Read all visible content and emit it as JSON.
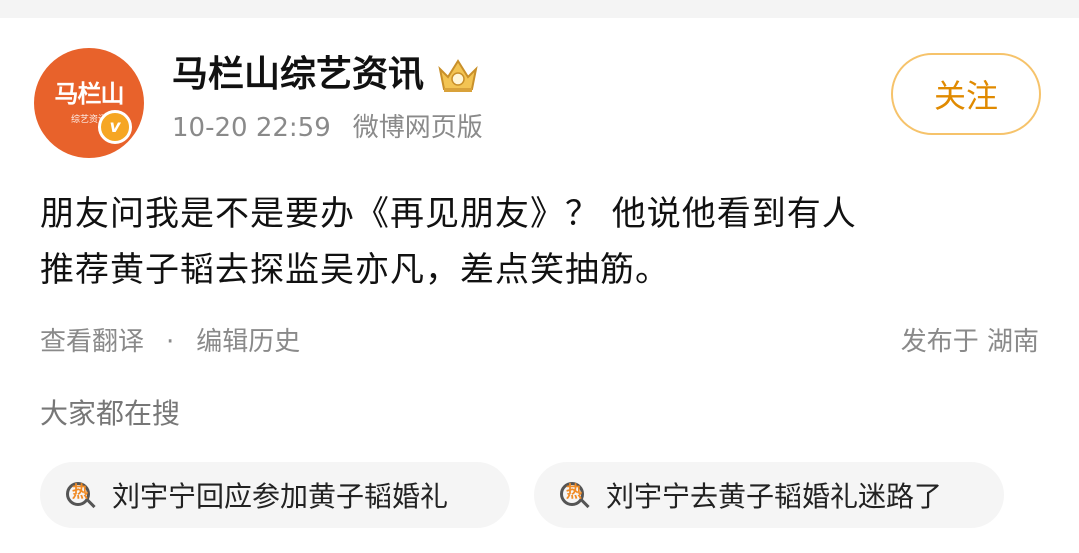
{
  "post": {
    "author": {
      "name": "马栏山综艺资讯",
      "avatar_text": "马栏山",
      "avatar_subtext": "综艺资讯",
      "verified_mark": "v"
    },
    "time": "10-20 22:59",
    "source": "微博网页版",
    "follow_label": "关注",
    "text_line1": "朋友问我是不是要办《再见朋友》？ 他说他看到有人",
    "text_line2": "推荐黄子韬去探监吴亦凡，差点笑抽筋。",
    "actions": {
      "translate": "查看翻译",
      "separator": "·",
      "edit_history": "编辑历史"
    },
    "location": "发布于 湖南"
  },
  "search": {
    "label": "大家都在搜",
    "chips": [
      {
        "hot_glyph": "热",
        "text": "刘宇宁回应参加黄子韬婚礼"
      },
      {
        "hot_glyph": "热",
        "text": "刘宇宁去黄子韬婚礼迷路了"
      }
    ]
  },
  "colors": {
    "accent": "#e08a00",
    "avatar_bg": "#e8622b",
    "muted_text": "#8a8a8a"
  }
}
